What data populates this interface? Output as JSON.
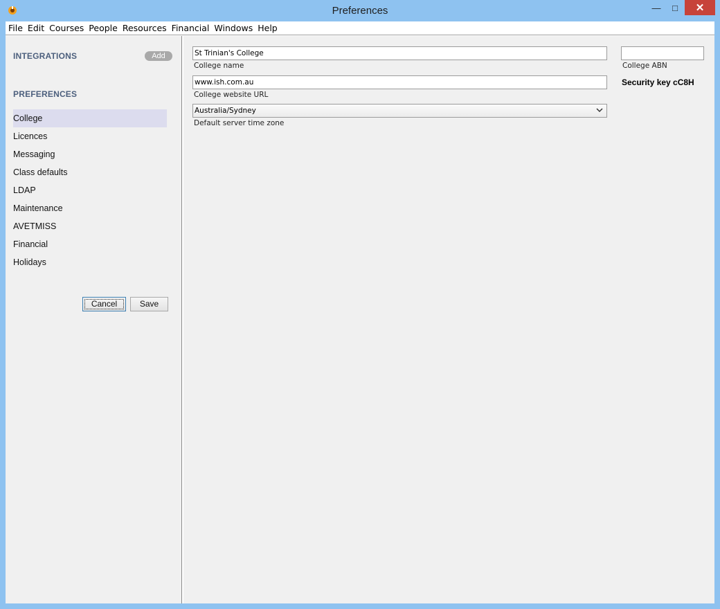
{
  "window": {
    "title": "Preferences",
    "minimize": "—",
    "maximize": "□",
    "close": "✕"
  },
  "menu": [
    "File",
    "Edit",
    "Courses",
    "People",
    "Resources",
    "Financial",
    "Windows",
    "Help"
  ],
  "sidebar": {
    "integrations_heading": "INTEGRATIONS",
    "add_label": "Add",
    "preferences_heading": "PREFERENCES",
    "items": [
      "College",
      "Licences",
      "Messaging",
      "Class defaults",
      "LDAP",
      "Maintenance",
      "AVETMISS",
      "Financial",
      "Holidays"
    ],
    "active_item": "College",
    "cancel_label": "Cancel",
    "save_label": "Save"
  },
  "form": {
    "college_name_value": "St Trinian's College",
    "college_name_label": "College name",
    "website_value": "www.ish.com.au",
    "website_label": "College website URL",
    "timezone_value": "Australia/Sydney",
    "timezone_label": "Default server time zone",
    "abn_value": "",
    "abn_label": "College ABN",
    "security_key": "Security key cC8H"
  },
  "icons": {
    "app_icon": "ish-app-icon",
    "dropdown": "chevron-down-icon"
  },
  "colors": {
    "frame": "#8ec2f0",
    "close_button": "#c7433a",
    "active_item": "#dcdcee",
    "section_heading": "#4c5f7d"
  }
}
